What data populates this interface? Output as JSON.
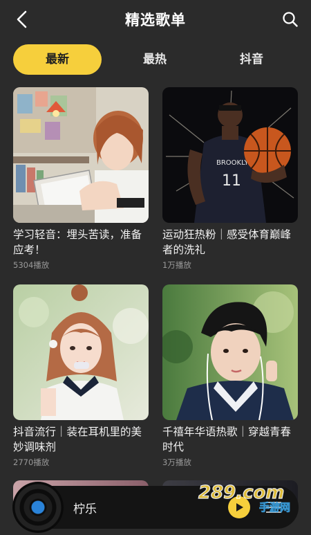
{
  "header": {
    "title": "精选歌单",
    "back_icon": "back-arrow-icon",
    "search_icon": "search-icon"
  },
  "tabs": [
    {
      "label": "最新",
      "active": true
    },
    {
      "label": "最热",
      "active": false
    },
    {
      "label": "抖音",
      "active": false
    }
  ],
  "playlists": [
    {
      "title": "学习轻音：埋头苦读，准备应考！",
      "plays": "5304播放"
    },
    {
      "title": "运动狂热粉｜感受体育巅峰者的洗礼",
      "plays": "1万播放"
    },
    {
      "title": "抖音流行｜装在耳机里的美妙调味剂",
      "plays": "2770播放"
    },
    {
      "title": "千禧年华语热歌｜穿越青春时代",
      "plays": "3万播放"
    }
  ],
  "player": {
    "title": "柠乐",
    "play_icon": "play-icon",
    "list_icon": "playlist-icon"
  },
  "watermark": {
    "text": "289.com",
    "sub": "手游网"
  },
  "colors": {
    "background": "#2b2b2b",
    "accent": "#f6cf3c",
    "player_bg": "#141414"
  }
}
